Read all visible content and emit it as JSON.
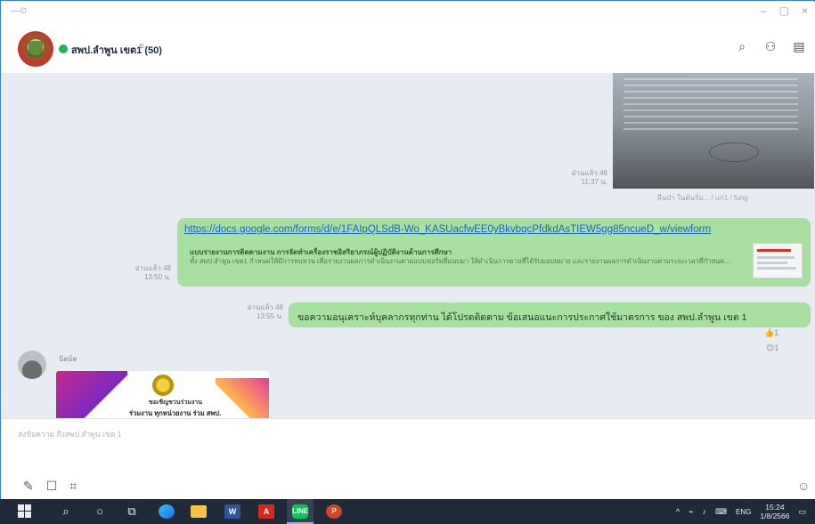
{
  "window": {
    "app_glyph": "—⊙",
    "controls": [
      "–",
      "▢",
      "×"
    ]
  },
  "header": {
    "chat_title": "สพป.ลำพูน เขต1 (50)",
    "caret": "≡",
    "icons": [
      "search-icon",
      "user-plus-icon",
      "panel-icon"
    ],
    "icon_glyphs": [
      "⌕",
      "⚇",
      "▤"
    ]
  },
  "messages": {
    "image_message": {
      "meta_read": "อ่านแล้ว 46",
      "meta_time": "11:37 น.",
      "caption": "ผืนป่า ในต้นรั่ม... / แก่1 / fung"
    },
    "link_message": {
      "url": "https://docs.google.com/forms/d/e/1FAIpQLSdB-Wo_KASUacfwEE0yBkvbqcPfdkdAsTIEW5gg85ncueD_w/viewform",
      "preview_title": "แบบรายงานการติดตามงาน การจัดทำเครื่องราชอิสริยาภรณ์ผู้ปฏิบัติงานด้านการศึกษา",
      "preview_desc": "ทั้ง สพป.ลำพูน เขต1 กำหนดให้มีการทบทวน เพื่อรายงานผลการดำเนินงานตามแบบฟอร์มที่แนบมา ให้ดำเนินการตามที่ได้รับมอบหมาย และรายงานผลการดำเนินงานตามระยะเวลาที่กำหนด...",
      "meta_read": "อ่านแล้ว 48",
      "meta_time": "13:50 น."
    },
    "text_message": {
      "text": "ขอความอนุเคราะห์บุคลากรทุกท่าน ได้โปรดติดตาม ข้อเสนอแนะการประกาศใช้มาตรการ ของ สพป.ลำพูน เขต 1",
      "meta_read": "อ่านแล้ว 48",
      "meta_time": "13:55 น.",
      "reaction": "👍1",
      "reaction_2": "😊1"
    },
    "incoming": {
      "sender_name": "นิตย์ต",
      "card_caption_1": "ขอเชิญชวนร่วมงาน",
      "card_caption_2": "ร่วมงาน ทุกหน่วยงาน ร่วม สพป."
    },
    "scroll_down": "↓"
  },
  "composer": {
    "placeholder": "ส่งข้อความ ถึงสพป.ลำพูน เขต 1"
  },
  "composer_tools": [
    "✎",
    "☐",
    "⌗"
  ],
  "emoji": "☺",
  "taskbar": {
    "word_label": "W",
    "acrobat_label": "A",
    "line_label": "LINE",
    "ppt_label": "P",
    "search_glyph": "⌕",
    "cortana_glyph": "○",
    "taskview_glyph": "⧉"
  },
  "tray": {
    "chevron": "^",
    "input_method": "ENG",
    "time": "15:24",
    "date": "1/8/2566",
    "notify_glyph": "▭"
  }
}
